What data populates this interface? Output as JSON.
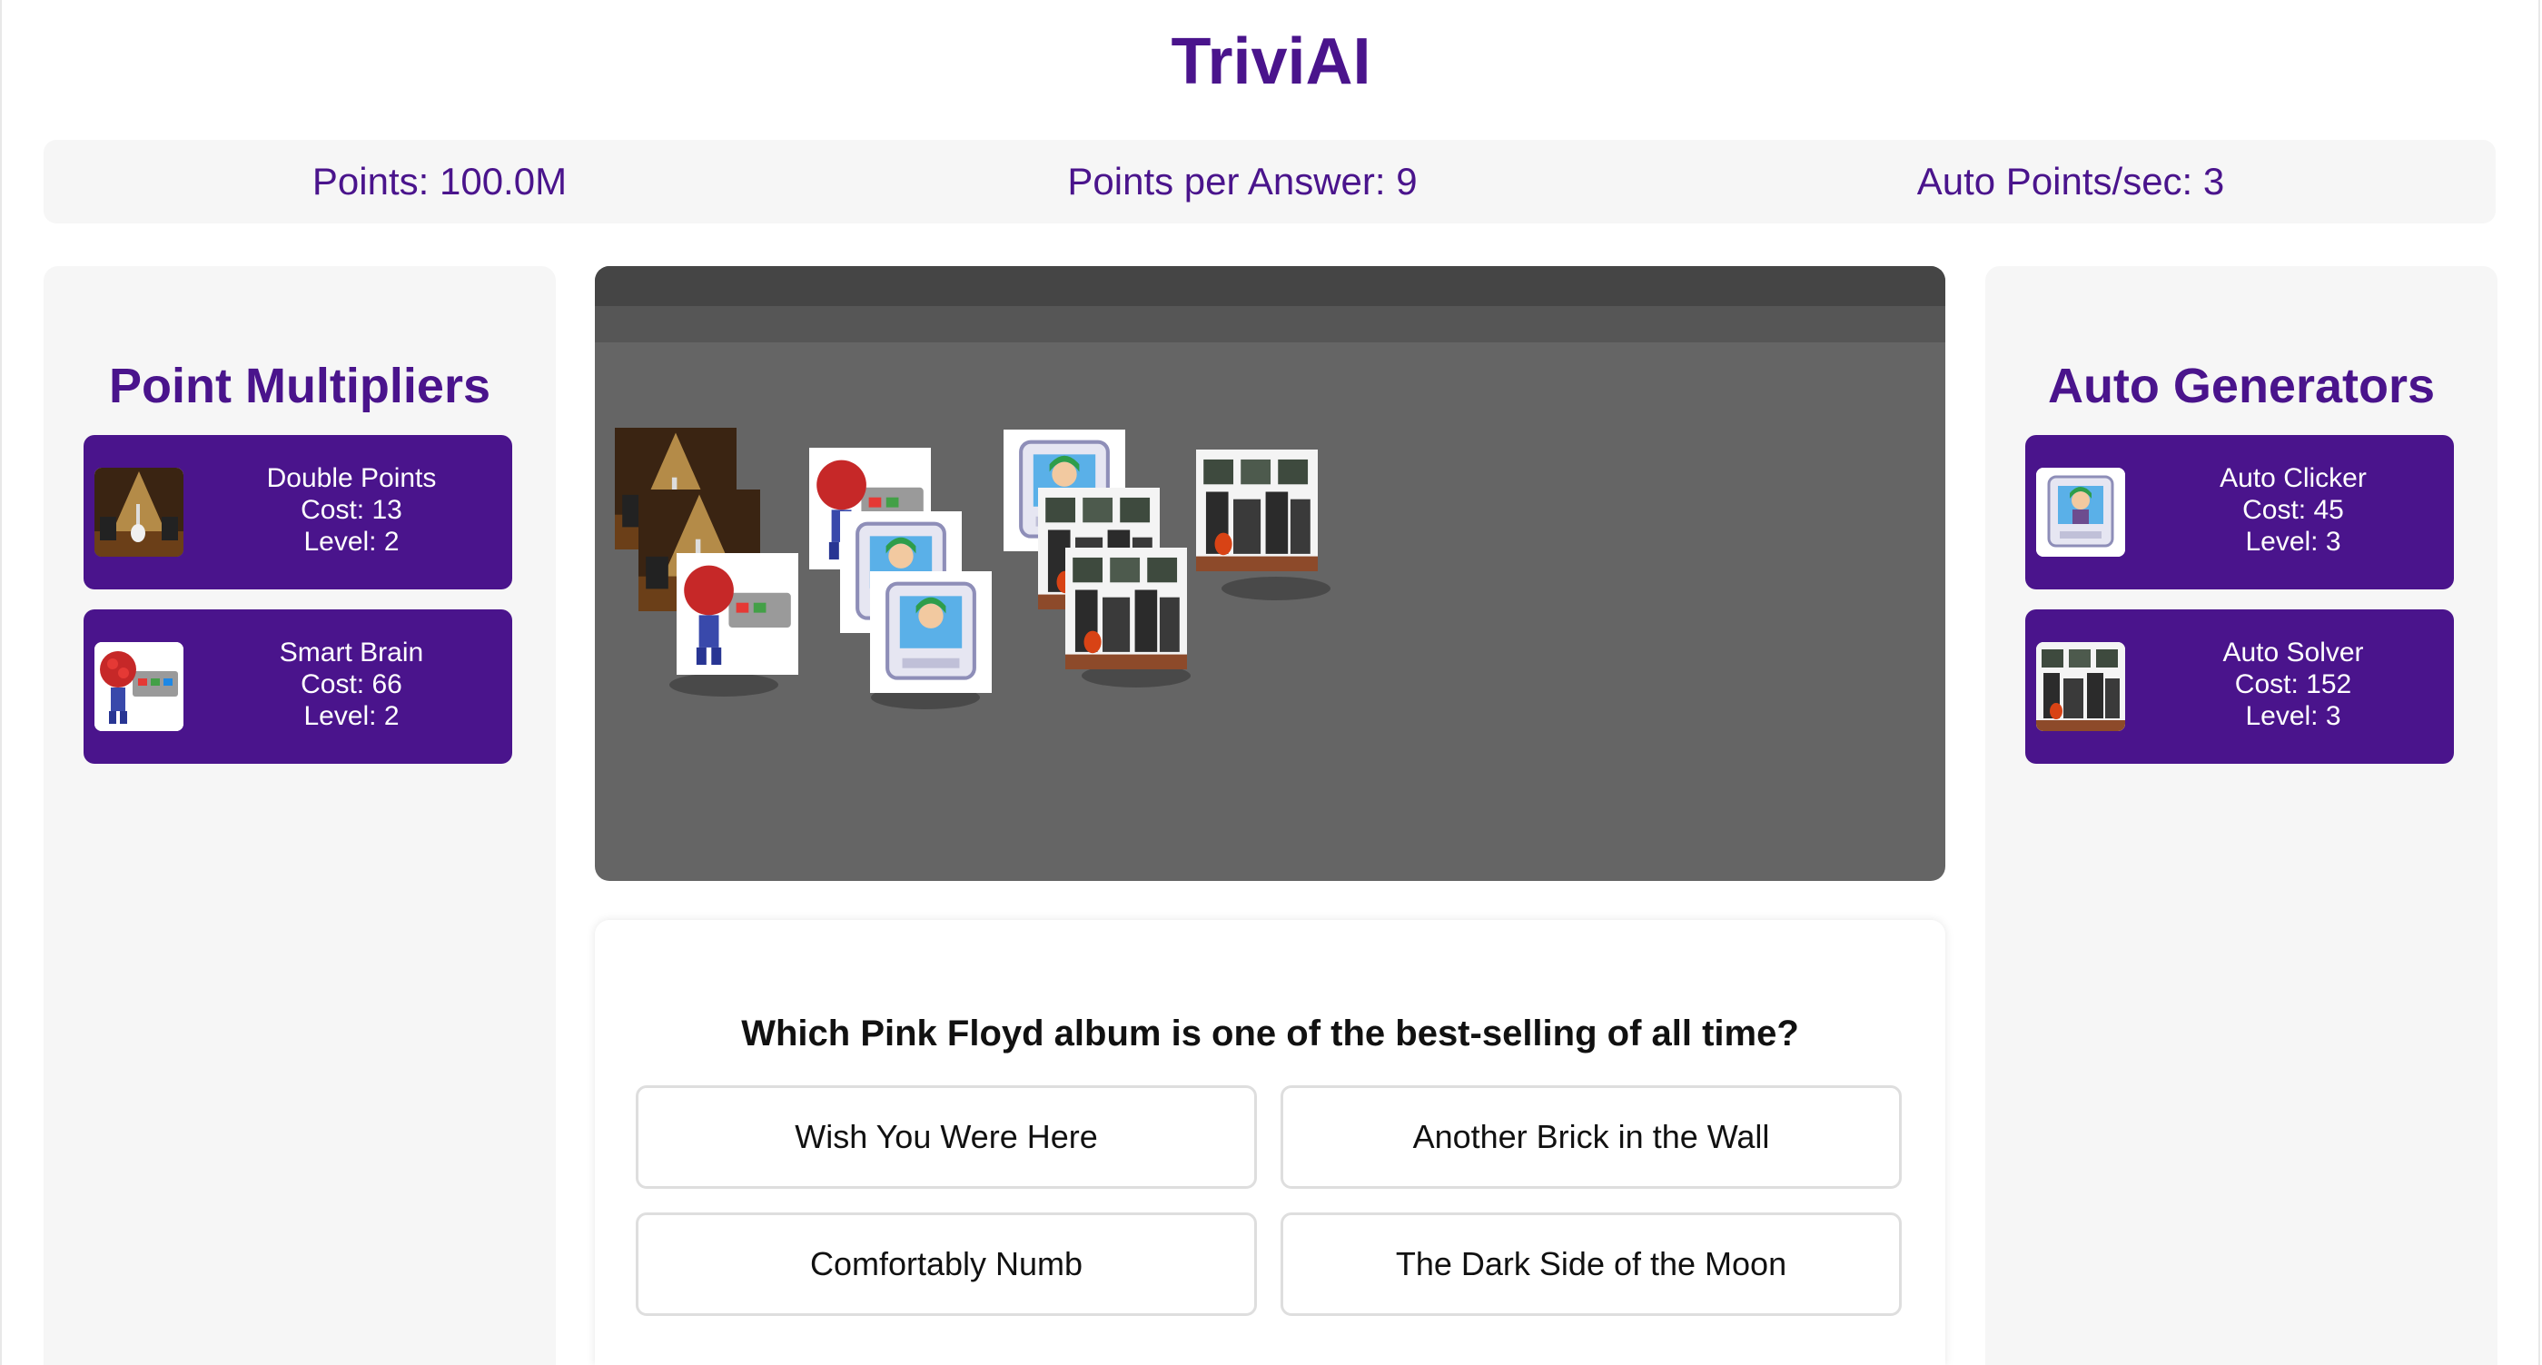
{
  "app": {
    "title": "TriviAI"
  },
  "stats": {
    "points": "Points: 100.0M",
    "points_per_answer": "Points per Answer: 9",
    "auto_points": "Auto Points/sec: 3"
  },
  "multipliers": {
    "title": "Point Multipliers",
    "items": [
      {
        "name": "Double Points",
        "cost": "Cost: 13",
        "level": "Level: 2",
        "icon": "stage-guitar-icon"
      },
      {
        "name": "Smart Brain",
        "cost": "Cost: 66",
        "level": "Level: 2",
        "icon": "brain-robot-icon"
      }
    ]
  },
  "generators": {
    "title": "Auto Generators",
    "items": [
      {
        "name": "Auto Clicker",
        "cost": "Cost: 45",
        "level": "Level: 3",
        "icon": "computer-monitor-icon"
      },
      {
        "name": "Auto Solver",
        "cost": "Cost: 152",
        "level": "Level: 3",
        "icon": "music-studio-icon"
      }
    ]
  },
  "quiz": {
    "question": "Which Pink Floyd album is one of the best-selling of all time?",
    "answers": [
      "Wish You Were Here",
      "Another Brick in the Wall",
      "Comfortably Numb",
      "The Dark Side of the Moon"
    ]
  },
  "colors": {
    "accent": "#4a148c",
    "panel": "#f6f6f6",
    "stage": "#656565"
  }
}
